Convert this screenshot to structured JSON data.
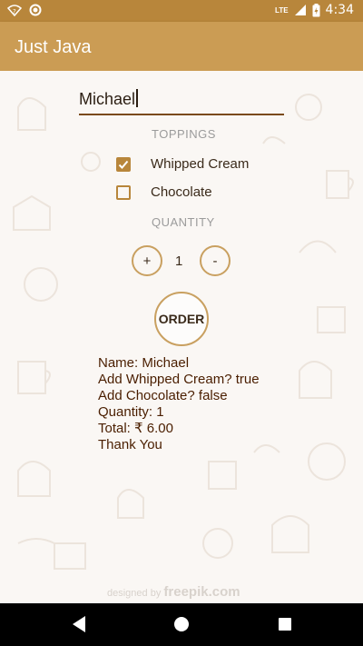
{
  "app_title": "Just Java",
  "status_bar": {
    "time": "4:34",
    "network_label": "LTE"
  },
  "form": {
    "name_value": "Michael",
    "toppings_label": "TOPPINGS",
    "whipped_cream": {
      "label": "Whipped Cream",
      "checked": true
    },
    "chocolate": {
      "label": "Chocolate",
      "checked": false
    },
    "quantity_label": "QUANTITY",
    "increment_label": "+",
    "quantity_value": "1",
    "decrement_label": "-",
    "order_label": "ORDER"
  },
  "summary": {
    "line1": "Name: Michael",
    "line2": "Add Whipped Cream? true",
    "line3": "Add Chocolate? false",
    "line4": "Quantity: 1",
    "line5": "Total: ₹ 6.00",
    "line6": "Thank You"
  },
  "credit": {
    "prefix": "designed by",
    "brand": "freepik.com"
  },
  "colors": {
    "status_bar": "#b8863b",
    "app_bar": "#cb9c54",
    "accent": "#b8863b",
    "summary_text": "#4a1e00"
  }
}
